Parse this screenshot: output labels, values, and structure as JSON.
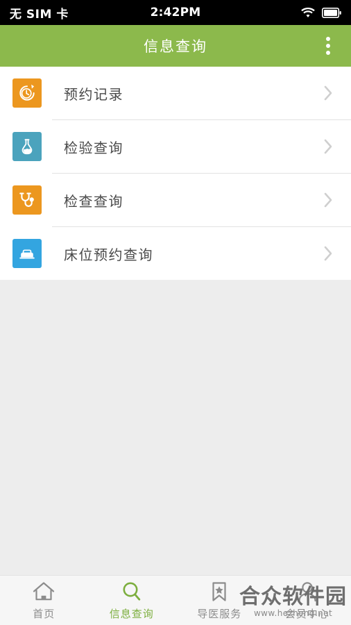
{
  "status_bar": {
    "carrier": "无 SIM 卡",
    "time": "2:42PM",
    "wifi_icon": "wifi-icon",
    "battery_icon": "battery-icon"
  },
  "header": {
    "title": "信息查询",
    "background_color": "#8cb94c",
    "overflow_icon": "overflow-menu-icon"
  },
  "list": {
    "items": [
      {
        "label": "预约记录",
        "icon": "clock-history-icon",
        "icon_color": "#ec971f",
        "chevron": "chevron-right-icon"
      },
      {
        "label": "检验查询",
        "icon": "flask-icon",
        "icon_color": "#4ba3bd",
        "chevron": "chevron-right-icon"
      },
      {
        "label": "检查查询",
        "icon": "stethoscope-icon",
        "icon_color": "#ec971f",
        "chevron": "chevron-right-icon"
      },
      {
        "label": "床位预约查询",
        "icon": "bed-icon",
        "icon_color": "#33a5e0",
        "chevron": "chevron-right-icon"
      }
    ]
  },
  "tab_bar": {
    "active_color": "#7cae3e",
    "inactive_color": "#8c8c8c",
    "tabs": [
      {
        "label": "首页",
        "icon": "home-icon",
        "active": false
      },
      {
        "label": "信息查询",
        "icon": "search-icon",
        "active": true
      },
      {
        "label": "导医服务",
        "icon": "bookmark-star-icon",
        "active": false
      },
      {
        "label": "会员中心",
        "icon": "user-icon",
        "active": false
      }
    ]
  },
  "watermark": {
    "title": "合众软件园",
    "url": "www.hezhong.net"
  }
}
